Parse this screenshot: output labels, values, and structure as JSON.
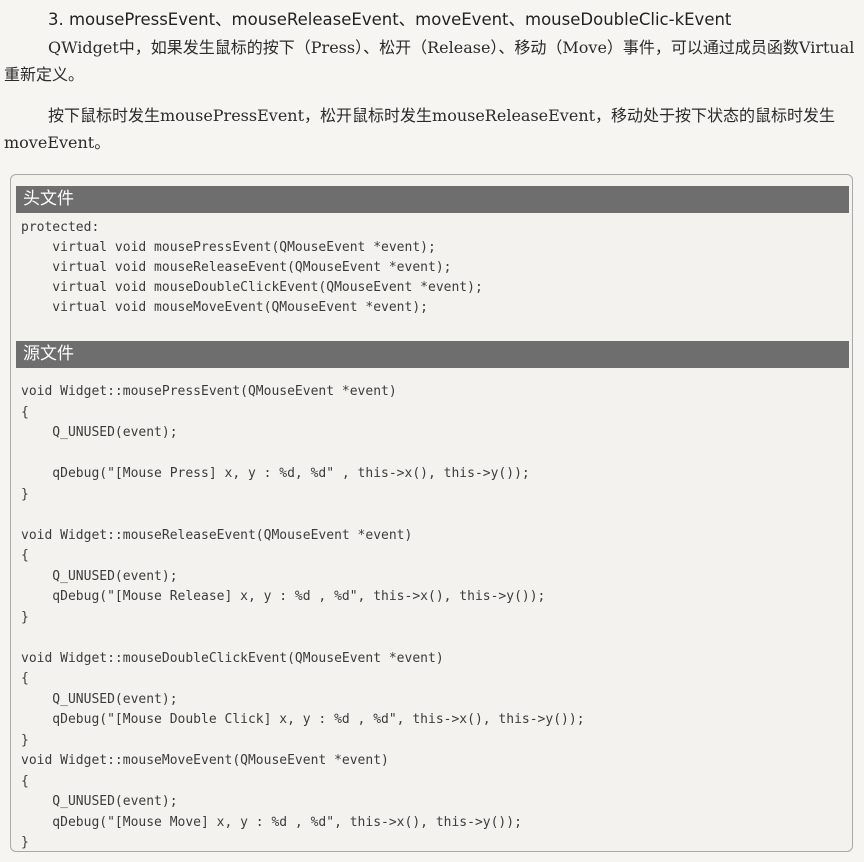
{
  "heading": "3. mousePressEvent、mouseReleaseEvent、moveEvent、mouseDoubleClic-kEvent",
  "paragraphs": [
    "QWidget中，如果发生鼠标的按下（Press）、松开（Release）、移动（Move）事件，可以通过成员函数Virtual重新定义。",
    "按下鼠标时发生mousePressEvent，松开鼠标时发生mouseReleaseEvent，移动处于按下状态的鼠标时发生moveEvent。"
  ],
  "header_file": {
    "label": "头文件",
    "lines": [
      "protected:",
      "    virtual void mousePressEvent(QMouseEvent *event);",
      "    virtual void mouseReleaseEvent(QMouseEvent *event);",
      "    virtual void mouseDoubleClickEvent(QMouseEvent *event);",
      "    virtual void mouseMoveEvent(QMouseEvent *event);"
    ]
  },
  "source_file": {
    "label": "源文件",
    "lines": [
      "void Widget::mousePressEvent(QMouseEvent *event)",
      "{",
      "    Q_UNUSED(event);",
      "",
      "    qDebug(\"[Mouse Press] x, y : %d, %d\" , this->x(), this->y());",
      "}",
      "",
      "void Widget::mouseReleaseEvent(QMouseEvent *event)",
      "{",
      "    Q_UNUSED(event);",
      "    qDebug(\"[Mouse Release] x, y : %d , %d\", this->x(), this->y());",
      "}",
      "",
      "void Widget::mouseDoubleClickEvent(QMouseEvent *event)",
      "{",
      "    Q_UNUSED(event);",
      "    qDebug(\"[Mouse Double Click] x, y : %d , %d\", this->x(), this->y());",
      "}",
      "void Widget::mouseMoveEvent(QMouseEvent *event)",
      "{",
      "    Q_UNUSED(event);",
      "    qDebug(\"[Mouse Move] x, y : %d , %d\", this->x(), this->y());",
      "}"
    ]
  }
}
